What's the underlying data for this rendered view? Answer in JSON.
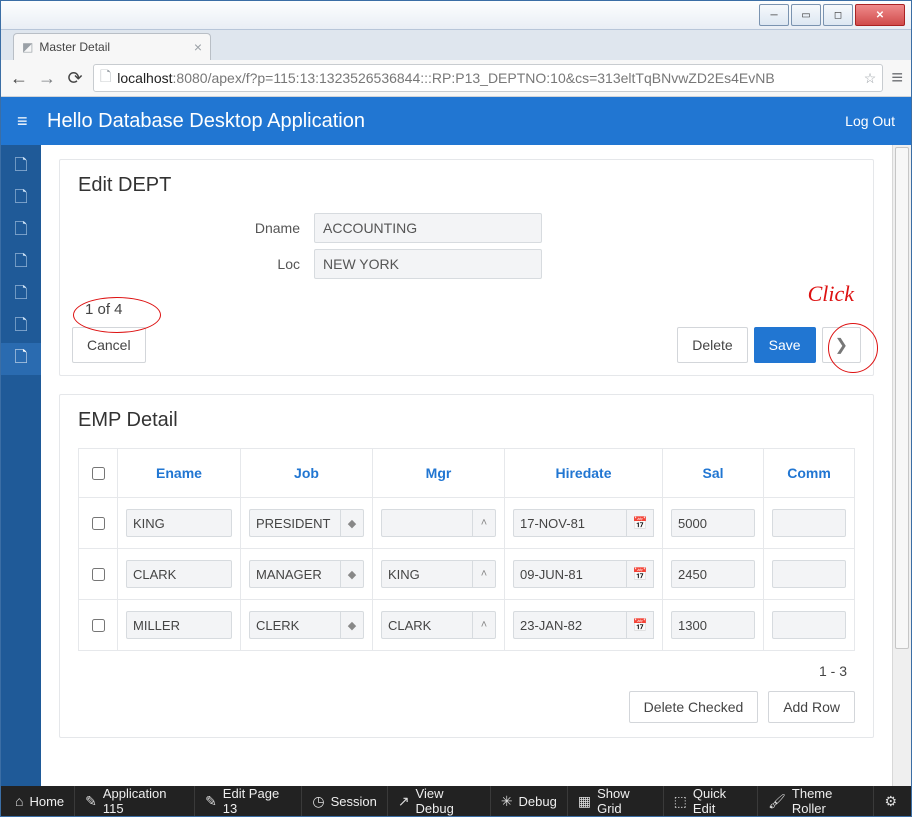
{
  "browser": {
    "tab_title": "Master Detail",
    "url_host": "localhost",
    "url_port": ":8080",
    "url_path": "/apex/f?p=115:13:1323526536844:::RP:P13_DEPTNO:10&cs=313eltTqBNvwZD2Es4EvNB"
  },
  "header": {
    "title": "Hello Database Desktop Application",
    "logout": "Log Out"
  },
  "dept_region": {
    "title": "Edit DEPT",
    "fields": {
      "dname_label": "Dname",
      "dname_value": "ACCOUNTING",
      "loc_label": "Loc",
      "loc_value": "NEW YORK"
    },
    "pager": "1 of 4",
    "buttons": {
      "cancel": "Cancel",
      "delete": "Delete",
      "save": "Save"
    }
  },
  "emp_region": {
    "title": "EMP Detail",
    "columns": {
      "ename": "Ename",
      "job": "Job",
      "mgr": "Mgr",
      "hiredate": "Hiredate",
      "sal": "Sal",
      "comm": "Comm"
    },
    "rows": [
      {
        "ename": "KING",
        "job": "PRESIDENT",
        "mgr": "",
        "hiredate": "17-NOV-81",
        "sal": "5000",
        "comm": ""
      },
      {
        "ename": "CLARK",
        "job": "MANAGER",
        "mgr": "KING",
        "hiredate": "09-JUN-81",
        "sal": "2450",
        "comm": ""
      },
      {
        "ename": "MILLER",
        "job": "CLERK",
        "mgr": "CLARK",
        "hiredate": "23-JAN-82",
        "sal": "1300",
        "comm": ""
      }
    ],
    "row_count": "1 - 3",
    "buttons": {
      "delete_checked": "Delete Checked",
      "add_row": "Add Row"
    }
  },
  "annotation": {
    "click": "Click"
  },
  "devbar": {
    "home": "Home",
    "application": "Application 115",
    "edit_page": "Edit Page 13",
    "session": "Session",
    "view_debug": "View Debug",
    "debug": "Debug",
    "show_grid": "Show Grid",
    "quick_edit": "Quick Edit",
    "theme_roller": "Theme Roller"
  }
}
